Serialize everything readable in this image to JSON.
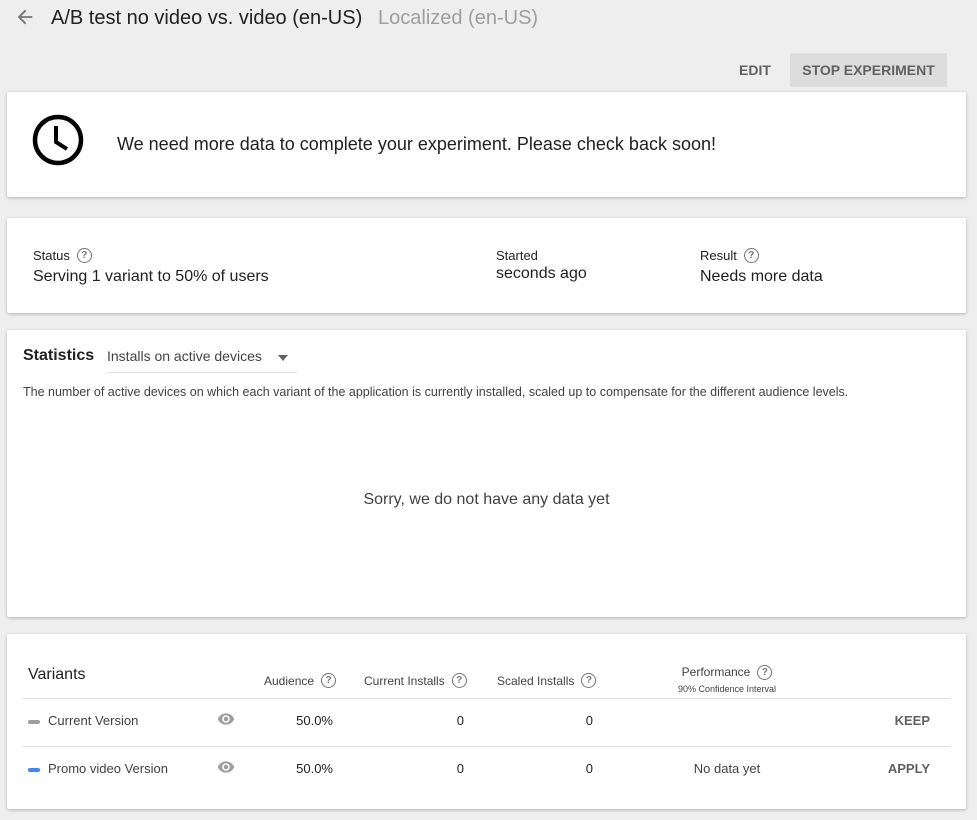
{
  "header": {
    "title": "A/B test no video vs. video (en-US)",
    "subtitle": "Localized (en-US)",
    "back_icon": "arrow-left-icon"
  },
  "toolbar": {
    "edit_label": "EDIT",
    "stop_label": "STOP EXPERIMENT"
  },
  "message": {
    "icon": "clock-icon",
    "text": "We need more data to complete your experiment. Please check back soon!"
  },
  "status": {
    "status_label": "Status",
    "status_value": "Serving 1 variant to 50% of users",
    "started_label": "Started",
    "started_value": "seconds ago",
    "result_label": "Result",
    "result_value": "Needs more data",
    "help_glyph": "?"
  },
  "statistics": {
    "title": "Statistics",
    "selected_metric": "Installs on active devices",
    "description": "The number of active devices on which each variant of the application is currently installed, scaled up to compensate for the different audience levels.",
    "empty_message": "Sorry, we do not have any data yet"
  },
  "variants": {
    "title": "Variants",
    "columns": {
      "audience": "Audience",
      "current_installs": "Current Installs",
      "scaled_installs": "Scaled Installs",
      "performance": "Performance",
      "performance_sub": "90% Confidence Interval"
    },
    "rows": [
      {
        "name": "Current Version",
        "color": "#9e9e9e",
        "audience": "50.0%",
        "current_installs": "0",
        "scaled_installs": "0",
        "performance": "",
        "action": "KEEP"
      },
      {
        "name": "Promo video Version",
        "color": "#4285f4",
        "audience": "50.0%",
        "current_installs": "0",
        "scaled_installs": "0",
        "performance": "No data yet",
        "action": "APPLY"
      }
    ]
  }
}
